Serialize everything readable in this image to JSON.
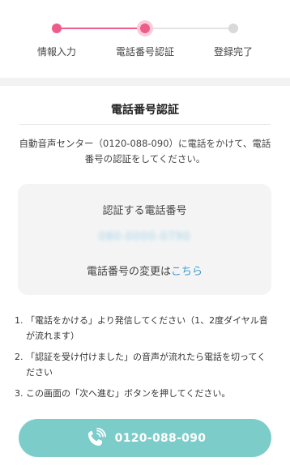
{
  "stepper": {
    "steps": [
      {
        "label": "情報入力",
        "state": "done"
      },
      {
        "label": "電話番号認証",
        "state": "current"
      },
      {
        "label": "登録完了",
        "state": "pending"
      }
    ],
    "colors": {
      "active": "#ee5d8a",
      "inactive": "#d9d9d9"
    }
  },
  "section": {
    "title": "電話番号認証",
    "description": "自動音声センター（0120-088-090）に電話をかけて、電話番号の認証をしてください。"
  },
  "card": {
    "label": "認証する電話番号",
    "masked_number": "080-0000-0790",
    "change_prefix": "電話番号の変更は",
    "change_link": "こちら"
  },
  "instructions": [
    {
      "num": "1.",
      "text": "「電話をかける」より発信してください（1、2度ダイヤル音が流れます）"
    },
    {
      "num": "2.",
      "text": "「認証を受け付けました」の音声が流れたら電話を切ってください"
    },
    {
      "num": "3.",
      "text": "この画面の「次へ進む」ボタンを押してください。"
    }
  ],
  "call_button": {
    "label": "0120-088-090",
    "icon": "phone-call-icon",
    "color": "#7ccdca"
  }
}
